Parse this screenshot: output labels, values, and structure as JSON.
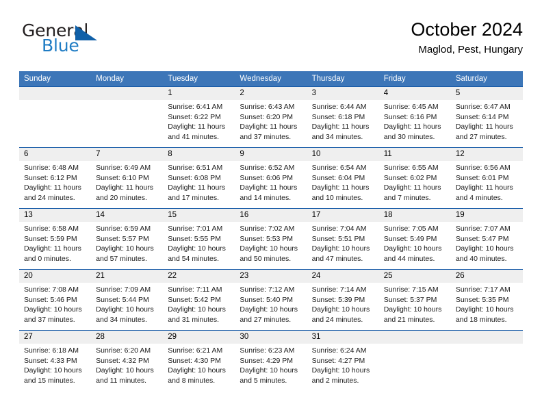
{
  "brand": {
    "name_part1": "General",
    "name_part2": "Blue",
    "triangle_icon": "blue-triangle-icon"
  },
  "header": {
    "title": "October 2024",
    "subtitle": "Maglod, Pest, Hungary"
  },
  "colors": {
    "header_blue": "#3d76b8",
    "row_rule_blue": "#1a5ca8",
    "daynum_band": "#efefef",
    "brand_blue": "#1f7cc4",
    "brand_dark": "#231f20"
  },
  "weekday_headers": [
    "Sunday",
    "Monday",
    "Tuesday",
    "Wednesday",
    "Thursday",
    "Friday",
    "Saturday"
  ],
  "labels": {
    "sunrise_prefix": "Sunrise: ",
    "sunset_prefix": "Sunset: ",
    "daylight_prefix": "Daylight: "
  },
  "weeks": [
    [
      {
        "day": "",
        "sunrise": "",
        "sunset": "",
        "daylight": ""
      },
      {
        "day": "",
        "sunrise": "",
        "sunset": "",
        "daylight": ""
      },
      {
        "day": "1",
        "sunrise": "Sunrise: 6:41 AM",
        "sunset": "Sunset: 6:22 PM",
        "daylight": "Daylight: 11 hours and 41 minutes."
      },
      {
        "day": "2",
        "sunrise": "Sunrise: 6:43 AM",
        "sunset": "Sunset: 6:20 PM",
        "daylight": "Daylight: 11 hours and 37 minutes."
      },
      {
        "day": "3",
        "sunrise": "Sunrise: 6:44 AM",
        "sunset": "Sunset: 6:18 PM",
        "daylight": "Daylight: 11 hours and 34 minutes."
      },
      {
        "day": "4",
        "sunrise": "Sunrise: 6:45 AM",
        "sunset": "Sunset: 6:16 PM",
        "daylight": "Daylight: 11 hours and 30 minutes."
      },
      {
        "day": "5",
        "sunrise": "Sunrise: 6:47 AM",
        "sunset": "Sunset: 6:14 PM",
        "daylight": "Daylight: 11 hours and 27 minutes."
      }
    ],
    [
      {
        "day": "6",
        "sunrise": "Sunrise: 6:48 AM",
        "sunset": "Sunset: 6:12 PM",
        "daylight": "Daylight: 11 hours and 24 minutes."
      },
      {
        "day": "7",
        "sunrise": "Sunrise: 6:49 AM",
        "sunset": "Sunset: 6:10 PM",
        "daylight": "Daylight: 11 hours and 20 minutes."
      },
      {
        "day": "8",
        "sunrise": "Sunrise: 6:51 AM",
        "sunset": "Sunset: 6:08 PM",
        "daylight": "Daylight: 11 hours and 17 minutes."
      },
      {
        "day": "9",
        "sunrise": "Sunrise: 6:52 AM",
        "sunset": "Sunset: 6:06 PM",
        "daylight": "Daylight: 11 hours and 14 minutes."
      },
      {
        "day": "10",
        "sunrise": "Sunrise: 6:54 AM",
        "sunset": "Sunset: 6:04 PM",
        "daylight": "Daylight: 11 hours and 10 minutes."
      },
      {
        "day": "11",
        "sunrise": "Sunrise: 6:55 AM",
        "sunset": "Sunset: 6:02 PM",
        "daylight": "Daylight: 11 hours and 7 minutes."
      },
      {
        "day": "12",
        "sunrise": "Sunrise: 6:56 AM",
        "sunset": "Sunset: 6:01 PM",
        "daylight": "Daylight: 11 hours and 4 minutes."
      }
    ],
    [
      {
        "day": "13",
        "sunrise": "Sunrise: 6:58 AM",
        "sunset": "Sunset: 5:59 PM",
        "daylight": "Daylight: 11 hours and 0 minutes."
      },
      {
        "day": "14",
        "sunrise": "Sunrise: 6:59 AM",
        "sunset": "Sunset: 5:57 PM",
        "daylight": "Daylight: 10 hours and 57 minutes."
      },
      {
        "day": "15",
        "sunrise": "Sunrise: 7:01 AM",
        "sunset": "Sunset: 5:55 PM",
        "daylight": "Daylight: 10 hours and 54 minutes."
      },
      {
        "day": "16",
        "sunrise": "Sunrise: 7:02 AM",
        "sunset": "Sunset: 5:53 PM",
        "daylight": "Daylight: 10 hours and 50 minutes."
      },
      {
        "day": "17",
        "sunrise": "Sunrise: 7:04 AM",
        "sunset": "Sunset: 5:51 PM",
        "daylight": "Daylight: 10 hours and 47 minutes."
      },
      {
        "day": "18",
        "sunrise": "Sunrise: 7:05 AM",
        "sunset": "Sunset: 5:49 PM",
        "daylight": "Daylight: 10 hours and 44 minutes."
      },
      {
        "day": "19",
        "sunrise": "Sunrise: 7:07 AM",
        "sunset": "Sunset: 5:47 PM",
        "daylight": "Daylight: 10 hours and 40 minutes."
      }
    ],
    [
      {
        "day": "20",
        "sunrise": "Sunrise: 7:08 AM",
        "sunset": "Sunset: 5:46 PM",
        "daylight": "Daylight: 10 hours and 37 minutes."
      },
      {
        "day": "21",
        "sunrise": "Sunrise: 7:09 AM",
        "sunset": "Sunset: 5:44 PM",
        "daylight": "Daylight: 10 hours and 34 minutes."
      },
      {
        "day": "22",
        "sunrise": "Sunrise: 7:11 AM",
        "sunset": "Sunset: 5:42 PM",
        "daylight": "Daylight: 10 hours and 31 minutes."
      },
      {
        "day": "23",
        "sunrise": "Sunrise: 7:12 AM",
        "sunset": "Sunset: 5:40 PM",
        "daylight": "Daylight: 10 hours and 27 minutes."
      },
      {
        "day": "24",
        "sunrise": "Sunrise: 7:14 AM",
        "sunset": "Sunset: 5:39 PM",
        "daylight": "Daylight: 10 hours and 24 minutes."
      },
      {
        "day": "25",
        "sunrise": "Sunrise: 7:15 AM",
        "sunset": "Sunset: 5:37 PM",
        "daylight": "Daylight: 10 hours and 21 minutes."
      },
      {
        "day": "26",
        "sunrise": "Sunrise: 7:17 AM",
        "sunset": "Sunset: 5:35 PM",
        "daylight": "Daylight: 10 hours and 18 minutes."
      }
    ],
    [
      {
        "day": "27",
        "sunrise": "Sunrise: 6:18 AM",
        "sunset": "Sunset: 4:33 PM",
        "daylight": "Daylight: 10 hours and 15 minutes."
      },
      {
        "day": "28",
        "sunrise": "Sunrise: 6:20 AM",
        "sunset": "Sunset: 4:32 PM",
        "daylight": "Daylight: 10 hours and 11 minutes."
      },
      {
        "day": "29",
        "sunrise": "Sunrise: 6:21 AM",
        "sunset": "Sunset: 4:30 PM",
        "daylight": "Daylight: 10 hours and 8 minutes."
      },
      {
        "day": "30",
        "sunrise": "Sunrise: 6:23 AM",
        "sunset": "Sunset: 4:29 PM",
        "daylight": "Daylight: 10 hours and 5 minutes."
      },
      {
        "day": "31",
        "sunrise": "Sunrise: 6:24 AM",
        "sunset": "Sunset: 4:27 PM",
        "daylight": "Daylight: 10 hours and 2 minutes."
      },
      {
        "day": "",
        "sunrise": "",
        "sunset": "",
        "daylight": ""
      },
      {
        "day": "",
        "sunrise": "",
        "sunset": "",
        "daylight": ""
      }
    ]
  ]
}
